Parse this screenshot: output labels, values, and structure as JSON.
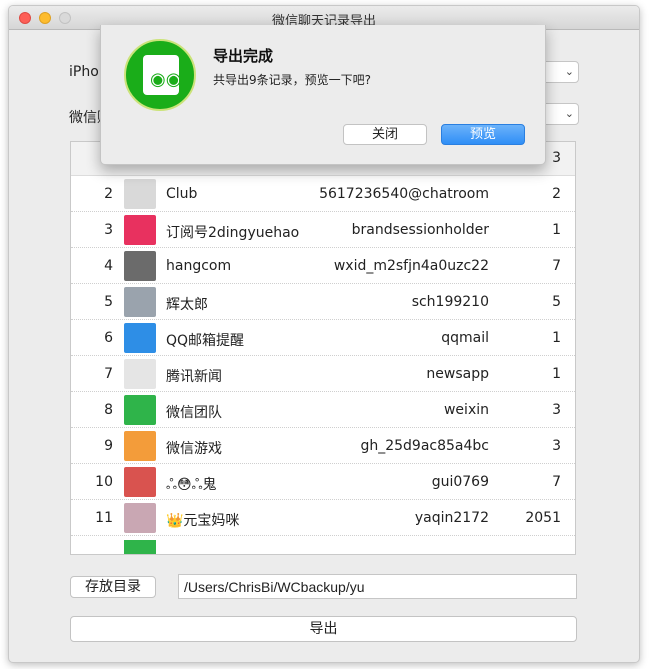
{
  "window": {
    "title": "微信聊天记录导出"
  },
  "form": {
    "iphone_label": "iPhone",
    "wechat_label": "微信账号"
  },
  "table": {
    "partial_first_count": "3",
    "rows": [
      {
        "index": "2",
        "name": "Club",
        "id": "5617236540@chatroom",
        "count": "2",
        "avatar_color": "#d9d9d9",
        "avatar_icon": "photo-avatar"
      },
      {
        "index": "3",
        "name": "订阅号2dingyuehao",
        "id": "brandsessionholder",
        "count": "1",
        "avatar_color": "#e8315f",
        "avatar_icon": "subscription-icon"
      },
      {
        "index": "4",
        "name": "hangcom",
        "id": "wxid_m2sfjn4a0uzc22",
        "count": "7",
        "avatar_color": "#6b6b6b",
        "avatar_icon": "photo-avatar"
      },
      {
        "index": "5",
        "name": "辉太郎",
        "id": "sch199210",
        "count": "5",
        "avatar_color": "#9aa3ad",
        "avatar_icon": "photo-avatar"
      },
      {
        "index": "6",
        "name": "QQ邮箱提醒",
        "id": "qqmail",
        "count": "1",
        "avatar_color": "#2e8ee6",
        "avatar_icon": "mail-icon"
      },
      {
        "index": "7",
        "name": "腾讯新闻",
        "id": "newsapp",
        "count": "1",
        "avatar_color": "#e5e5e5",
        "avatar_icon": "news-icon"
      },
      {
        "index": "8",
        "name": "微信团队",
        "id": "weixin",
        "count": "3",
        "avatar_color": "#2fb44a",
        "avatar_icon": "wechat-icon"
      },
      {
        "index": "9",
        "name": "微信游戏",
        "id": "gh_25d9ac85a4bc",
        "count": "3",
        "avatar_color": "#f39c3a",
        "avatar_icon": "game-icon"
      },
      {
        "index": "10",
        "name": "ஃ😳ஃ鬼",
        "id": "gui0769",
        "count": "7",
        "avatar_color": "#d9534f",
        "avatar_icon": "photo-avatar"
      },
      {
        "index": "11",
        "name": "👑元宝妈咪",
        "id": "yaqin2172",
        "count": "2051",
        "avatar_color": "#c9a7b3",
        "avatar_icon": "photo-avatar"
      }
    ]
  },
  "storage": {
    "button_label": "存放目录",
    "path_value": "/Users/ChrisBi/WCbackup/yu"
  },
  "export_button": "导出",
  "dialog": {
    "title": "导出完成",
    "message": "共导出9条记录，预览一下吧?",
    "close_label": "关闭",
    "preview_label": "预览"
  },
  "colors": {
    "accent": "#2f8ef6",
    "wechat_green": "#1aad19"
  }
}
